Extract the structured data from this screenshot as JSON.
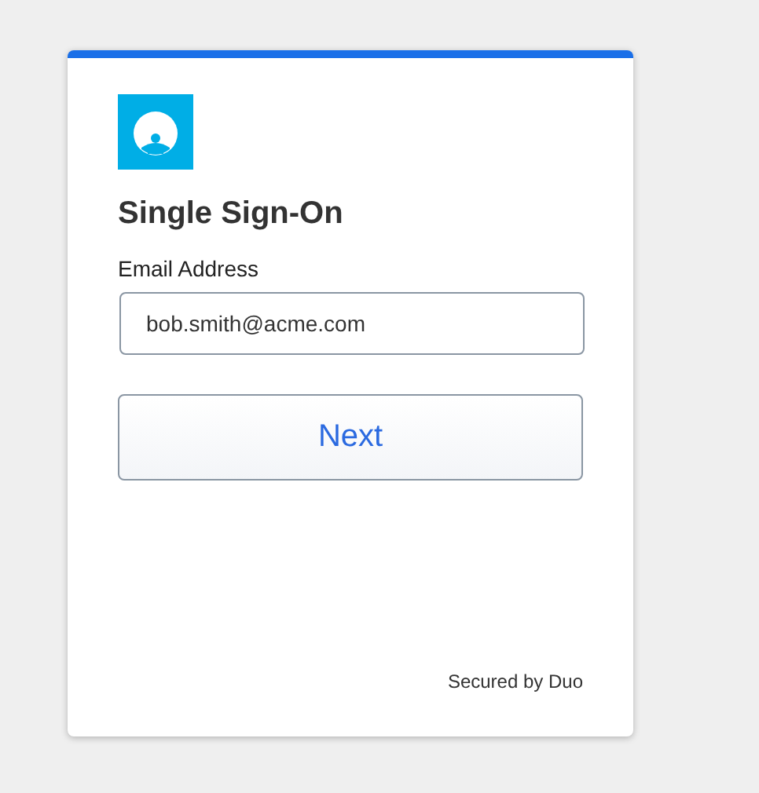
{
  "card": {
    "title": "Single Sign-On",
    "email": {
      "label": "Email Address",
      "value": "bob.smith@acme.com"
    },
    "next_button": "Next",
    "footer": "Secured by Duo"
  }
}
